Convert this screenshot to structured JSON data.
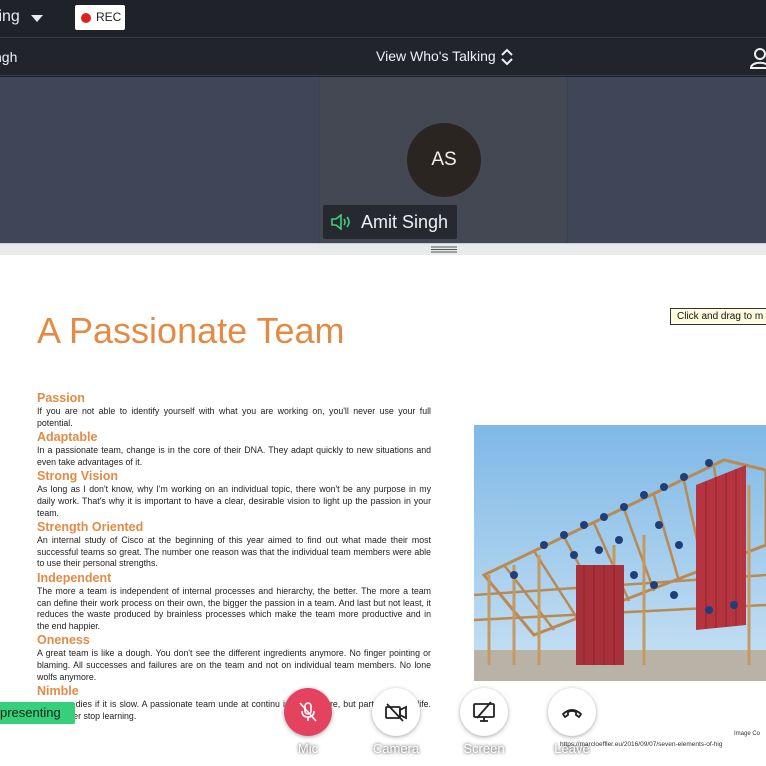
{
  "topbar": {
    "meeting_title": "ting",
    "record_label": "REC"
  },
  "subbar": {
    "current_speaker": "ngh",
    "view_toggle_label": "View Who's Talking"
  },
  "video": {
    "avatar_initials": "AS",
    "participant_name": "Amit Singh"
  },
  "slide": {
    "tooltip": "Click and drag to m",
    "title": "A Passionate Team",
    "sections": [
      {
        "heading": "Passion",
        "text": "If you are not able to identify yourself with what you are working on, you'll never use your full potential."
      },
      {
        "heading": "Adaptable",
        "text": "In a passionate team, change is in the core of their DNA. They adapt quickly to new situations and even take advantages of it."
      },
      {
        "heading": "Strong Vision",
        "text": "As long as I don't know, why I'm working on an individual topic, there won't be any purpose in my daily work. That's why it is important to have a clear, desirable vision to light up the passion in your team."
      },
      {
        "heading": "Strength Oriented",
        "text": "An internal study of Cisco at the beginning of this year aimed to find out what made their most successful teams so great. The number one reason was that the individual team members were able to use their personal strengths."
      },
      {
        "heading": "Independent",
        "text": "The more a team is independent of internal processes and hierarchy, the better. The more a team can define their work process on their own, the bigger the passion in a team. And last but not least, it reduces the waste produced by brainless processes which make the team more productive and in the end happier."
      },
      {
        "heading": "Oneness",
        "text": "A great team is like a dough. You don't see the different ingredients anymore. No finger pointing or blaming. All successes and failures are on the team and not on individual team members. No lone wolfs anymore."
      },
      {
        "heading": "Nimble",
        "text": "company dies if it is slow. A passionate team unde at continu is not a chore, but part of normal life. They never stop learning."
      }
    ],
    "image_credit": "Image Co",
    "image_url": "https://marcloeffler.eu/2016/09/07/seven-elements-of-hig"
  },
  "controls": {
    "presenting_label": "presenting",
    "mic_label": "Mic",
    "camera_label": "Camera",
    "screen_label": "Screen",
    "leave_label": "Leave",
    "mic_color": "#e3435f"
  }
}
